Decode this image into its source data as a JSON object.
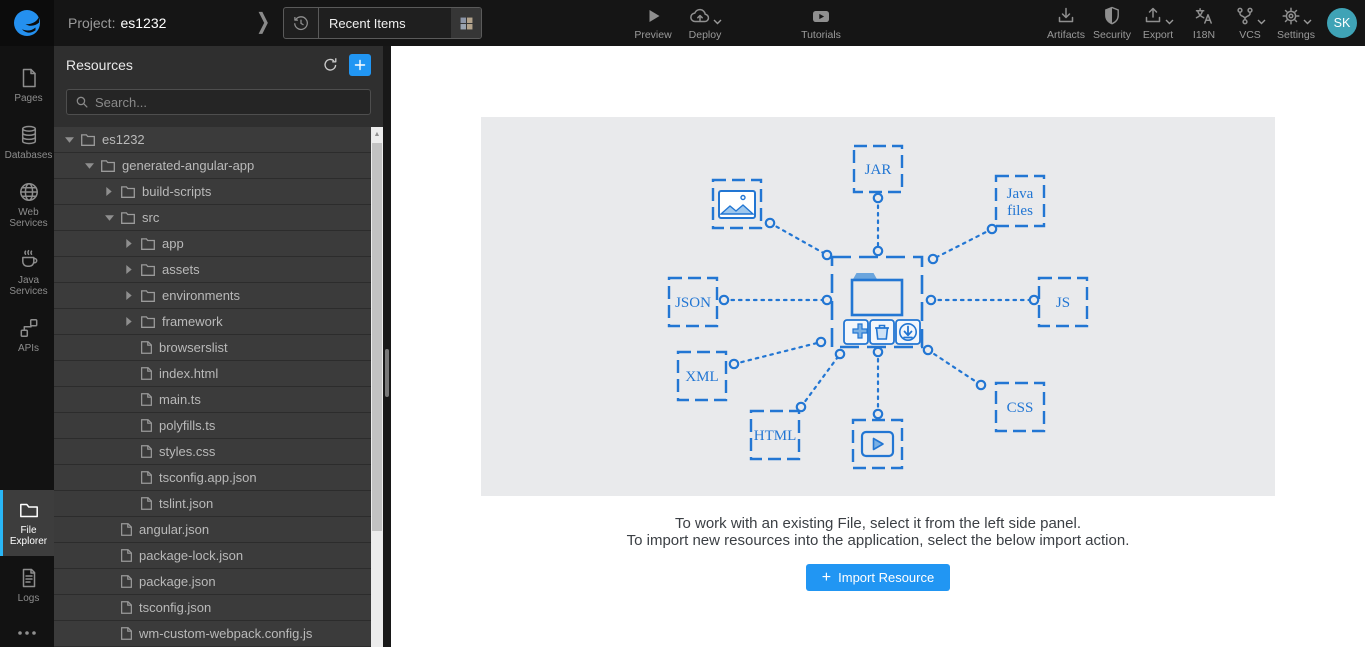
{
  "topbar": {
    "project_label": "Project:",
    "project_name": "es1232",
    "recent_items_label": "Recent Items",
    "actions_center": [
      {
        "label": "Preview",
        "icon": "play-icon",
        "has_dropdown": false
      },
      {
        "label": "Deploy",
        "icon": "cloud-upload-icon",
        "has_dropdown": true
      },
      {
        "label": "Tutorials",
        "icon": "youtube-icon",
        "has_dropdown": false
      }
    ],
    "actions_right": [
      {
        "label": "Artifacts",
        "icon": "download-icon",
        "has_dropdown": false
      },
      {
        "label": "Security",
        "icon": "shield-icon",
        "has_dropdown": false
      },
      {
        "label": "Export",
        "icon": "upload-icon",
        "has_dropdown": true
      },
      {
        "label": "I18N",
        "icon": "translate-icon",
        "has_dropdown": false
      },
      {
        "label": "VCS",
        "icon": "branch-icon",
        "has_dropdown": true
      },
      {
        "label": "Settings",
        "icon": "gear-icon",
        "has_dropdown": true
      }
    ],
    "avatar_initials": "SK"
  },
  "sidebar": {
    "items": [
      {
        "label": "Pages",
        "icon": "page-icon",
        "active": false
      },
      {
        "label": "Databases",
        "icon": "database-icon",
        "active": false
      },
      {
        "label": "Web Services",
        "icon": "globe-icon",
        "active": false
      },
      {
        "label": "Java Services",
        "icon": "coffee-icon",
        "active": false
      },
      {
        "label": "APIs",
        "icon": "api-icon",
        "active": false
      },
      {
        "label": "File Explorer",
        "icon": "folder-icon",
        "active": true
      },
      {
        "label": "Logs",
        "icon": "logs-icon",
        "active": false
      }
    ]
  },
  "resources_panel": {
    "title": "Resources",
    "search_placeholder": "Search...",
    "tree": [
      {
        "label": "es1232",
        "type": "folder",
        "depth": 0,
        "expanded": true
      },
      {
        "label": "generated-angular-app",
        "type": "folder",
        "depth": 1,
        "expanded": true
      },
      {
        "label": "build-scripts",
        "type": "folder",
        "depth": 2,
        "expanded": false
      },
      {
        "label": "src",
        "type": "folder",
        "depth": 2,
        "expanded": true
      },
      {
        "label": "app",
        "type": "folder",
        "depth": 3,
        "expanded": false
      },
      {
        "label": "assets",
        "type": "folder",
        "depth": 3,
        "expanded": false
      },
      {
        "label": "environments",
        "type": "folder",
        "depth": 3,
        "expanded": false
      },
      {
        "label": "framework",
        "type": "folder",
        "depth": 3,
        "expanded": false
      },
      {
        "label": "browserslist",
        "type": "file",
        "depth": 3
      },
      {
        "label": "index.html",
        "type": "file",
        "depth": 3
      },
      {
        "label": "main.ts",
        "type": "file",
        "depth": 3
      },
      {
        "label": "polyfills.ts",
        "type": "file",
        "depth": 3
      },
      {
        "label": "styles.css",
        "type": "file",
        "depth": 3
      },
      {
        "label": "tsconfig.app.json",
        "type": "file",
        "depth": 3
      },
      {
        "label": "tslint.json",
        "type": "file",
        "depth": 3
      },
      {
        "label": "angular.json",
        "type": "file",
        "depth": 2
      },
      {
        "label": "package-lock.json",
        "type": "file",
        "depth": 2
      },
      {
        "label": "package.json",
        "type": "file",
        "depth": 2
      },
      {
        "label": "tsconfig.json",
        "type": "file",
        "depth": 2
      },
      {
        "label": "wm-custom-webpack.config.js",
        "type": "file",
        "depth": 2
      }
    ]
  },
  "main": {
    "diagram": {
      "nodes": [
        {
          "id": "jar",
          "label": "JAR"
        },
        {
          "id": "java-files",
          "lines": [
            "Java",
            "files"
          ]
        },
        {
          "id": "json",
          "label": "JSON"
        },
        {
          "id": "js",
          "label": "JS"
        },
        {
          "id": "xml",
          "label": "XML"
        },
        {
          "id": "css",
          "label": "CSS"
        },
        {
          "id": "html",
          "label": "HTML"
        },
        {
          "id": "image"
        },
        {
          "id": "video"
        }
      ],
      "center_tools": [
        "add",
        "delete",
        "download"
      ]
    },
    "instructions_line1": "To work with an existing File, select it from the left side panel.",
    "instructions_line2": "To import new resources into the application, select the below import action.",
    "import_button_label": "Import Resource"
  },
  "colors": {
    "accent": "#2196f3",
    "diagram_blue": "#2276d3",
    "avatar_teal": "#3fa3b6",
    "topbar_bg": "#151515",
    "panel_bg": "#2f2f2f"
  }
}
